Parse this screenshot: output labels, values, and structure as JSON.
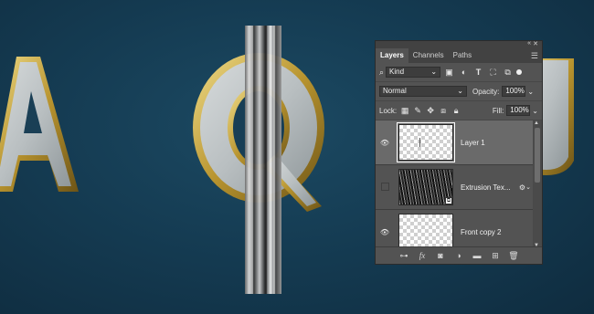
{
  "panel": {
    "tabs": [
      "Layers",
      "Channels",
      "Paths"
    ],
    "active_tab": "Layers",
    "filter": {
      "kind_label": "Kind",
      "icons": [
        "image-filter-icon",
        "adjustment-filter-icon",
        "type-filter-icon",
        "shape-filter-icon",
        "smart-object-filter-icon"
      ]
    },
    "blend": {
      "mode": "Normal",
      "opacity_label": "Opacity:",
      "opacity_value": "100%"
    },
    "lock": {
      "label": "Lock:",
      "fill_label": "Fill:",
      "fill_value": "100%"
    },
    "layers": [
      {
        "name": "Layer 1",
        "visible": true,
        "selected": true,
        "thumb": "transparent"
      },
      {
        "name": "Extrusion Tex...",
        "visible": false,
        "selected": false,
        "thumb": "texture",
        "has_fx": true
      },
      {
        "name": "Front copy 2",
        "visible": true,
        "selected": false,
        "thumb": "transparent"
      }
    ],
    "bottom_icons": [
      "link-layers-icon",
      "fx-icon",
      "add-mask-icon",
      "adjustment-layer-icon",
      "new-group-icon",
      "new-layer-icon",
      "delete-layer-icon"
    ],
    "fx_text": "fx"
  },
  "colors": {
    "canvas_bg": "#153c53",
    "panel_bg": "#535353",
    "selected_layer": "#6a6a6a",
    "gold": "#b89a3a"
  }
}
